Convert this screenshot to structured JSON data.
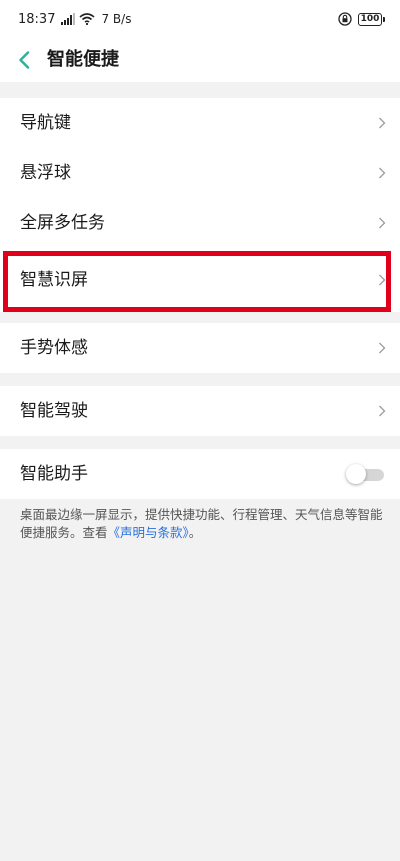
{
  "status_bar": {
    "time": "18:37",
    "network_speed": "7 B/s",
    "battery": "100",
    "icons": [
      "signal-icon",
      "wifi-icon",
      "lock-rotation-icon",
      "battery-icon"
    ]
  },
  "header": {
    "title": "智能便捷",
    "back_icon": "chevron-left-icon"
  },
  "settings": {
    "group1": [
      {
        "label": "导航键"
      },
      {
        "label": "悬浮球"
      },
      {
        "label": "全屏多任务"
      },
      {
        "label": "智慧识屏"
      }
    ],
    "group2": [
      {
        "label": "手势体感"
      }
    ],
    "group3": [
      {
        "label": "智能驾驶"
      }
    ],
    "assistant": {
      "label": "智能助手",
      "enabled": false
    }
  },
  "footnote": {
    "text": "桌面最边缘一屏显示，提供快捷功能、行程管理、天气信息等智能便捷服务。查看",
    "link": "《声明与条款》",
    "end": "。"
  },
  "colors": {
    "accent": "#2bb39a",
    "highlight": "#e0001b",
    "link": "#2a6fdb",
    "background": "#f2f2f2"
  }
}
